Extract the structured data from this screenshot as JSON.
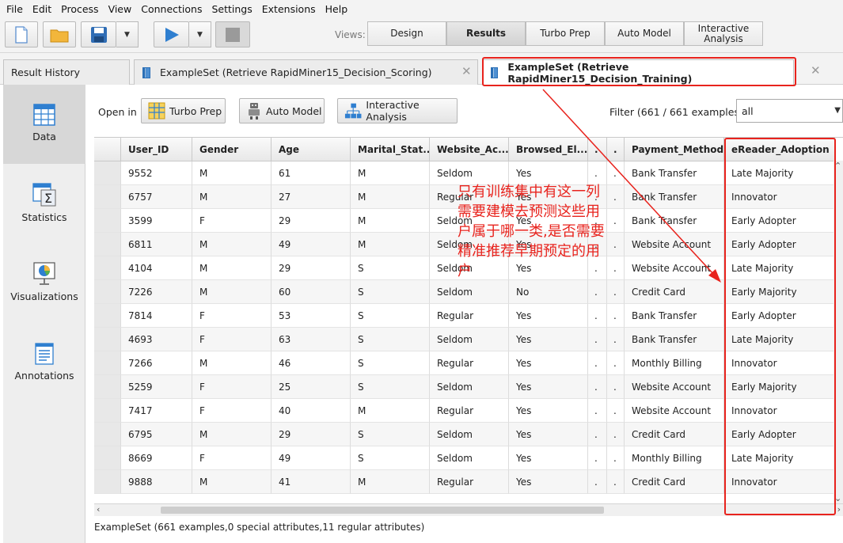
{
  "menu": [
    "File",
    "Edit",
    "Process",
    "View",
    "Connections",
    "Settings",
    "Extensions",
    "Help"
  ],
  "toolbar": {
    "views_label": "Views:"
  },
  "views": [
    {
      "label": "Design",
      "active": false
    },
    {
      "label": "Results",
      "active": true
    },
    {
      "label": "Turbo Prep",
      "active": false
    },
    {
      "label": "Auto Model",
      "active": false
    },
    {
      "label": "Interactive Analysis",
      "active": false
    }
  ],
  "tabs": [
    {
      "label": "Result History",
      "active": false
    },
    {
      "label": "ExampleSet (Retrieve RapidMiner15_Decision_Scoring)",
      "active": false
    },
    {
      "label": "ExampleSet (Retrieve RapidMiner15_Decision_Training)",
      "active": true
    }
  ],
  "sidebar": [
    {
      "label": "Data",
      "icon": "table-icon",
      "active": true
    },
    {
      "label": "Statistics",
      "icon": "sigma-icon",
      "active": false
    },
    {
      "label": "Visualizations",
      "icon": "pie-chart-icon",
      "active": false
    },
    {
      "label": "Annotations",
      "icon": "note-icon",
      "active": false
    }
  ],
  "openin": {
    "label": "Open in",
    "turbo_prep": "Turbo Prep",
    "auto_model": "Auto Model",
    "interactive_analysis": "Interactive Analysis"
  },
  "filter": {
    "label": "Filter (661 / 661 examples):",
    "value": "all"
  },
  "table": {
    "columns": [
      "User_ID",
      "Gender",
      "Age",
      "Marital_Stat...",
      "Website_Ac...",
      "Browsed_El...",
      ".",
      ".",
      "Payment_Method",
      "eReader_Adoption"
    ],
    "rows": [
      [
        "9552",
        "M",
        "61",
        "M",
        "Seldom",
        "Yes",
        ".",
        ".",
        "Bank Transfer",
        "Late Majority"
      ],
      [
        "6757",
        "M",
        "27",
        "M",
        "Regular",
        "Yes",
        ".",
        ".",
        "Bank Transfer",
        "Innovator"
      ],
      [
        "3599",
        "F",
        "29",
        "M",
        "Seldom",
        "Yes",
        ".",
        ".",
        "Bank Transfer",
        "Early Adopter"
      ],
      [
        "6811",
        "M",
        "49",
        "M",
        "Seldom",
        "Yes",
        ".",
        ".",
        "Website Account",
        "Early Adopter"
      ],
      [
        "4104",
        "M",
        "29",
        "S",
        "Seldom",
        "Yes",
        ".",
        ".",
        "Website Account",
        "Late Majority"
      ],
      [
        "7226",
        "M",
        "60",
        "S",
        "Seldom",
        "No",
        ".",
        ".",
        "Credit Card",
        "Early Majority"
      ],
      [
        "7814",
        "F",
        "53",
        "S",
        "Regular",
        "Yes",
        ".",
        ".",
        "Bank Transfer",
        "Early Adopter"
      ],
      [
        "4693",
        "F",
        "63",
        "S",
        "Seldom",
        "Yes",
        ".",
        ".",
        "Bank Transfer",
        "Late Majority"
      ],
      [
        "7266",
        "M",
        "46",
        "S",
        "Regular",
        "Yes",
        ".",
        ".",
        "Monthly Billing",
        "Innovator"
      ],
      [
        "5259",
        "F",
        "25",
        "S",
        "Seldom",
        "Yes",
        ".",
        ".",
        "Website Account",
        "Early Majority"
      ],
      [
        "7417",
        "F",
        "40",
        "M",
        "Regular",
        "Yes",
        ".",
        ".",
        "Website Account",
        "Innovator"
      ],
      [
        "6795",
        "M",
        "29",
        "S",
        "Seldom",
        "Yes",
        ".",
        ".",
        "Credit Card",
        "Early Adopter"
      ],
      [
        "8669",
        "F",
        "49",
        "S",
        "Seldom",
        "Yes",
        ".",
        ".",
        "Monthly Billing",
        "Late Majority"
      ],
      [
        "9888",
        "M",
        "41",
        "M",
        "Regular",
        "Yes",
        ".",
        ".",
        "Credit Card",
        "Innovator"
      ]
    ]
  },
  "status": "ExampleSet (661 examples,0 special attributes,11 regular attributes)",
  "annotation": {
    "text": "只有训练集中有这一列\n需要建模去预测这些用\n户属于哪一类,是否需要\n精准推荐早期预定的用\n户",
    "color": "#e8231d"
  },
  "colors": {
    "accent_blue": "#2f7fd0",
    "highlight_red": "#e8231d"
  }
}
